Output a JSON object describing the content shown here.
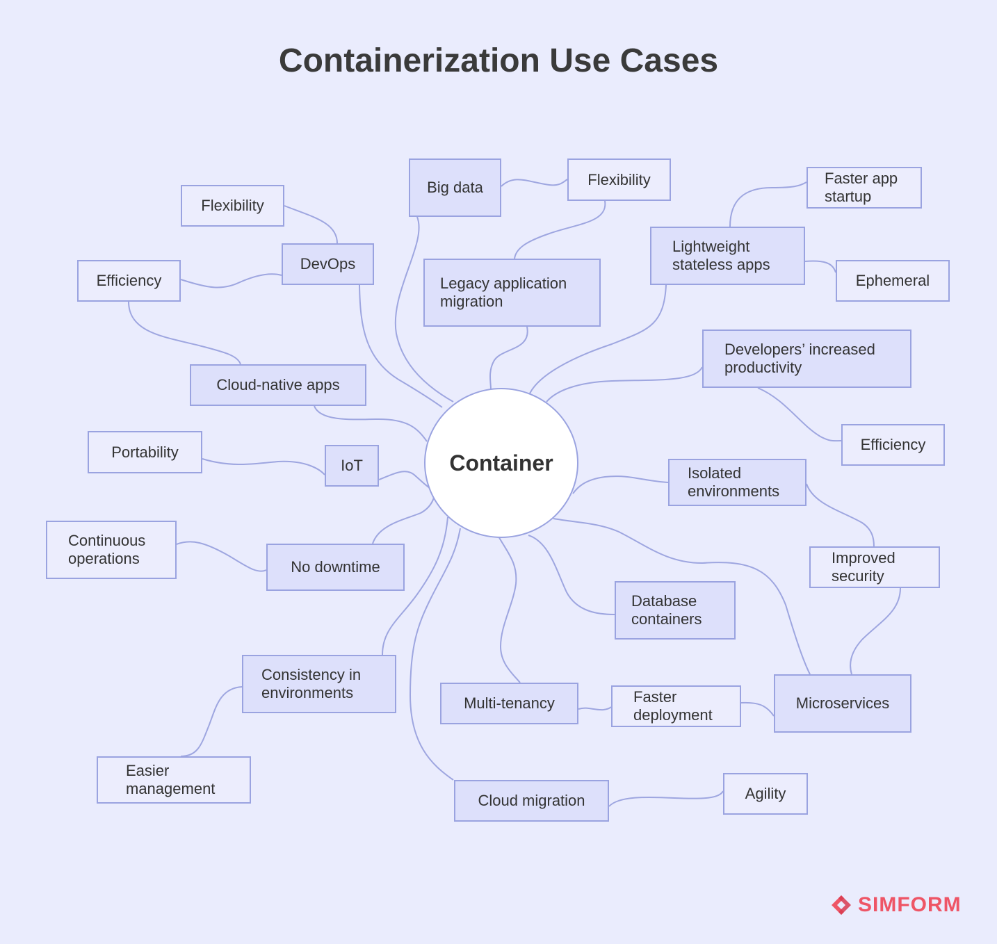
{
  "title": "Containerization Use Cases",
  "hub": {
    "label": "Container"
  },
  "nodes": {
    "big_data": "Big data",
    "flex_bigdata": "Flexibility",
    "legacy": "Legacy application\nmigration",
    "lightweight": "Lightweight\nstateless apps",
    "faster_startup": "Faster app\nstartup",
    "ephemeral": "Ephemeral",
    "devops": "DevOps",
    "flex_devops": "Flexibility",
    "efficiency_left": "Efficiency",
    "cloud_native": "Cloud-native apps",
    "dev_productivity": "Developers’ increased\nproductivity",
    "efficiency_right": "Efficiency",
    "portability": "Portability",
    "iot": "IoT",
    "isolated": "Isolated\nenvironments",
    "improved_security": "Improved\nsecurity",
    "continuous_ops": "Continuous\noperations",
    "no_downtime": "No downtime",
    "database": "Database\ncontainers",
    "consistency": "Consistency in\nenvironments",
    "easier_mgmt": "Easier\nmanagement",
    "multi_tenancy": "Multi-tenancy",
    "faster_deploy": "Faster\ndeployment",
    "microservices": "Microservices",
    "cloud_migration": "Cloud migration",
    "agility": "Agility"
  },
  "brand": {
    "name": "SIMFORM",
    "color": "#ee5566"
  }
}
